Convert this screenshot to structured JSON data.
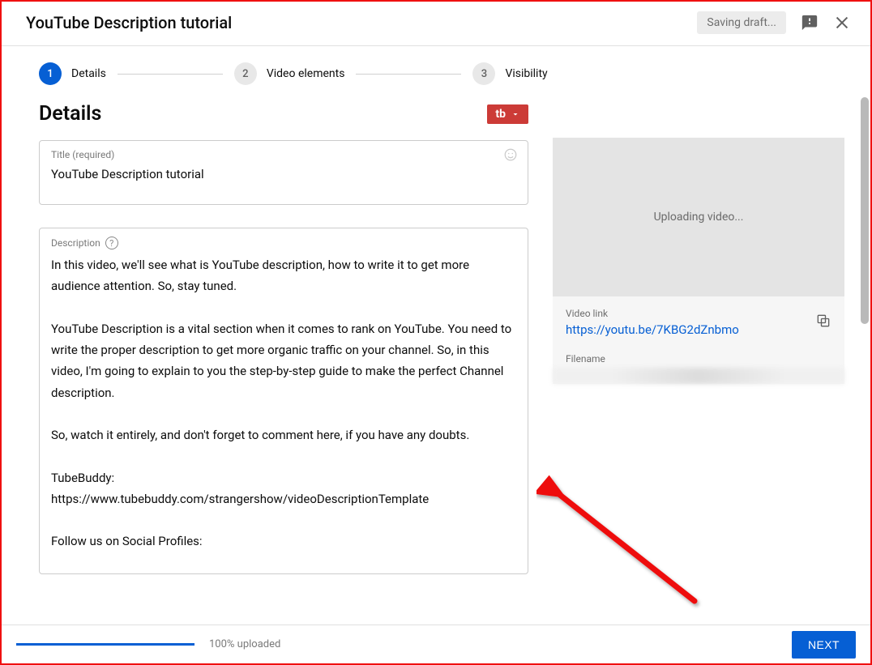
{
  "header": {
    "title": "YouTube Description tutorial",
    "saving": "Saving draft..."
  },
  "stepper": {
    "steps": [
      {
        "num": "1",
        "label": "Details"
      },
      {
        "num": "2",
        "label": "Video elements"
      },
      {
        "num": "3",
        "label": "Visibility"
      }
    ]
  },
  "details": {
    "heading": "Details",
    "tb_label": "tb",
    "title_field": {
      "label": "Title (required)",
      "value": "YouTube Description tutorial"
    },
    "description_field": {
      "label": "Description",
      "value": "In this video, we'll see what is YouTube description, how to write it to get more audience attention. So, stay tuned.\n\nYouTube Description is a vital section when it comes to rank on YouTube. You need to write the proper description to get more organic traffic on your channel. So, in this video, I'm going to explain to you the step-by-step guide to make the perfect Channel description.\n\nSo, watch it entirely, and don't forget to comment here, if you have any doubts.\n\nTubeBuddy:\nhttps://www.tubebuddy.com/strangershow/videoDescriptionTemplate\n\nFollow us on Social Profiles:"
    }
  },
  "sidebar": {
    "uploading": "Uploading video...",
    "video_link_label": "Video link",
    "video_link": "https://youtu.be/7KBG2dZnbmo",
    "filename_label": "Filename"
  },
  "footer": {
    "uploaded": "100% uploaded",
    "next": "NEXT"
  }
}
